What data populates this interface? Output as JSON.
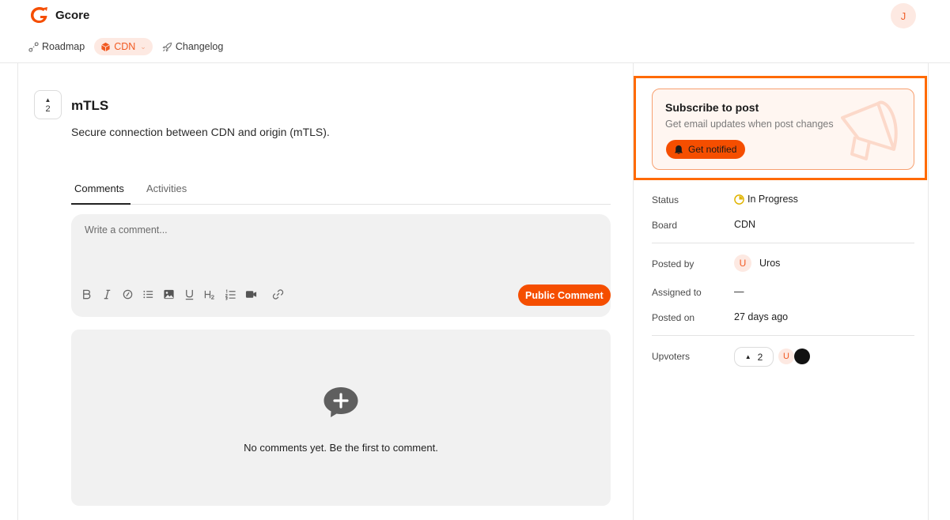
{
  "brand": {
    "name": "Gcore",
    "accent": "#f54e00"
  },
  "user": {
    "initial": "J"
  },
  "nav": {
    "items": [
      {
        "label": "Roadmap",
        "icon": "roadmap-icon"
      },
      {
        "label": "CDN",
        "icon": "cube-icon",
        "active": true
      },
      {
        "label": "Changelog",
        "icon": "rocket-icon"
      }
    ]
  },
  "post": {
    "votes": "2",
    "title": "mTLS",
    "description": "Secure connection between CDN and origin (mTLS)."
  },
  "tabs": {
    "comments": "Comments",
    "activities": "Activities"
  },
  "composer": {
    "placeholder": "Write a comment...",
    "submit_label": "Public Comment",
    "tools": [
      "bold-icon",
      "italic-icon",
      "code-icon",
      "bullet-list-icon",
      "image-icon",
      "underline-icon",
      "heading-icon",
      "numbered-list-icon",
      "video-icon",
      "link-icon"
    ]
  },
  "empty": {
    "text": "No comments yet. Be the first to comment."
  },
  "subscribe": {
    "title": "Subscribe to post",
    "description": "Get email updates when post changes",
    "button_label": "Get notified"
  },
  "meta": {
    "status_label": "Status",
    "status_value": "In Progress",
    "board_label": "Board",
    "board_value": "CDN",
    "posted_by_label": "Posted by",
    "posted_by_initial": "U",
    "posted_by_value": "Uros",
    "assigned_label": "Assigned to",
    "assigned_value": "—",
    "posted_on_label": "Posted on",
    "posted_on_value": "27 days ago",
    "upvoters_label": "Upvoters",
    "upvoters_count": "2",
    "upvoter_initial": "U"
  }
}
